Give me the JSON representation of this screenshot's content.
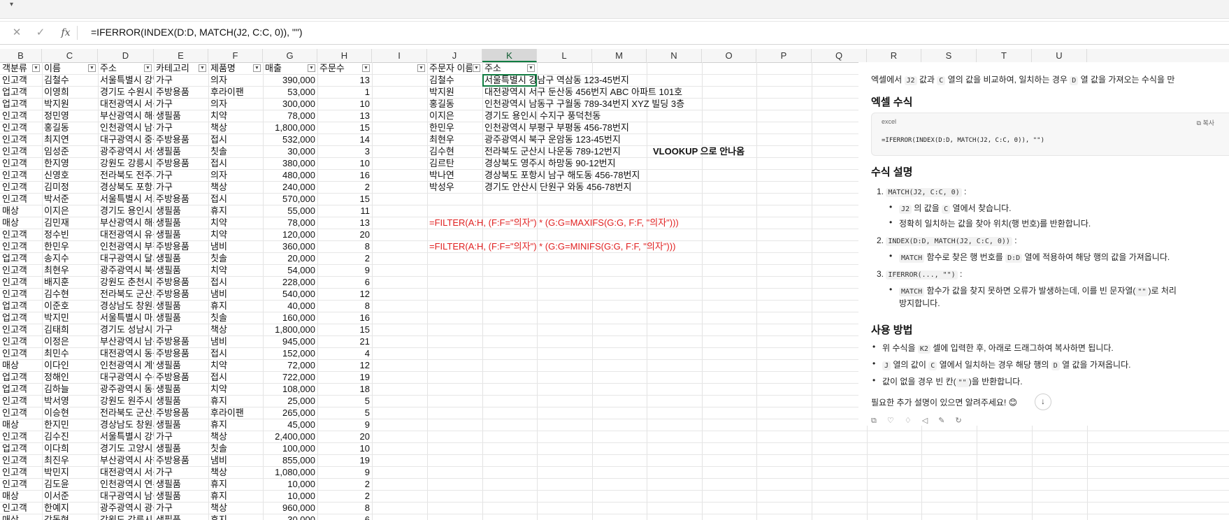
{
  "formula_bar": {
    "cancel_icon": "x-icon",
    "enter_icon": "check-icon",
    "fx_label": "fx",
    "formula": "=IFERROR(INDEX(D:D, MATCH(J2, C:C, 0)), \"\")"
  },
  "columns": [
    "B",
    "C",
    "D",
    "E",
    "F",
    "G",
    "H",
    "I",
    "J",
    "K",
    "L",
    "M",
    "N",
    "O",
    "P",
    "Q",
    "R",
    "S",
    "T",
    "U"
  ],
  "selected_column": "K",
  "table_left": {
    "headers": [
      "객분류",
      "이름",
      "주소",
      "카테고리",
      "제품명",
      "매출",
      "주문수"
    ],
    "rows": [
      [
        "인고객",
        "김철수",
        "서울특별시 강남구",
        "가구",
        "의자",
        "390,000",
        "13"
      ],
      [
        "업고객",
        "이영희",
        "경기도 수원시",
        "주방용품",
        "후라이팬",
        "53,000",
        "1"
      ],
      [
        "업고객",
        "박지원",
        "대전광역시 서구",
        "가구",
        "의자",
        "300,000",
        "10"
      ],
      [
        "인고객",
        "정민영",
        "부산광역시 해운대구",
        "생필품",
        "치약",
        "78,000",
        "13"
      ],
      [
        "인고객",
        "홍길동",
        "인천광역시 남동구",
        "가구",
        "책상",
        "1,800,000",
        "15"
      ],
      [
        "인고객",
        "최지연",
        "대구광역시 중구",
        "주방용품",
        "접시",
        "532,000",
        "14"
      ],
      [
        "인고객",
        "임성준",
        "광주광역시 서구",
        "생필품",
        "칫솔",
        "30,000",
        "3"
      ],
      [
        "인고객",
        "한지영",
        "강원도 강릉시",
        "주방용품",
        "접시",
        "380,000",
        "10"
      ],
      [
        "인고객",
        "신영호",
        "전라북도 전주시",
        "가구",
        "의자",
        "480,000",
        "16"
      ],
      [
        "인고객",
        "김미정",
        "경상북도 포항시",
        "가구",
        "책상",
        "240,000",
        "2"
      ],
      [
        "인고객",
        "박서준",
        "서울특별시 서초구",
        "주방용품",
        "접시",
        "570,000",
        "15"
      ],
      [
        "매상",
        "이지은",
        "경기도 용인시",
        "생필품",
        "휴지",
        "55,000",
        "11"
      ],
      [
        "매상",
        "김민재",
        "부산광역시 해운대구",
        "생필품",
        "치약",
        "78,000",
        "13"
      ],
      [
        "인고객",
        "정수빈",
        "대전광역시 유성구",
        "생필품",
        "치약",
        "120,000",
        "20"
      ],
      [
        "인고객",
        "한민우",
        "인천광역시 부평구",
        "주방용품",
        "냄비",
        "360,000",
        "8"
      ],
      [
        "업고객",
        "송지수",
        "대구광역시 달서구",
        "생필품",
        "칫솔",
        "20,000",
        "2"
      ],
      [
        "인고객",
        "최현우",
        "광주광역시 북구",
        "생필품",
        "치약",
        "54,000",
        "9"
      ],
      [
        "인고객",
        "배지훈",
        "강원도 춘천시",
        "주방용품",
        "접시",
        "228,000",
        "6"
      ],
      [
        "인고객",
        "김수현",
        "전라북도 군산시",
        "주방용품",
        "냄비",
        "540,000",
        "12"
      ],
      [
        "업고객",
        "이준호",
        "경상남도 창원시",
        "생필품",
        "휴지",
        "40,000",
        "8"
      ],
      [
        "업고객",
        "박지민",
        "서울특별시 마포구",
        "생필품",
        "칫솔",
        "160,000",
        "16"
      ],
      [
        "인고객",
        "김태희",
        "경기도 성남시",
        "가구",
        "책상",
        "1,800,000",
        "15"
      ],
      [
        "인고객",
        "이정은",
        "부산광역시 남구",
        "주방용품",
        "냄비",
        "945,000",
        "21"
      ],
      [
        "인고객",
        "최민수",
        "대전광역시 동구",
        "주방용품",
        "접시",
        "152,000",
        "4"
      ],
      [
        "매상",
        "이다인",
        "인천광역시 계양구",
        "생필품",
        "치약",
        "72,000",
        "12"
      ],
      [
        "업고객",
        "정해인",
        "대구광역시 수성구",
        "주방용품",
        "접시",
        "722,000",
        "19"
      ],
      [
        "업고객",
        "김하늘",
        "광주광역시 동구",
        "생필품",
        "치약",
        "108,000",
        "18"
      ],
      [
        "인고객",
        "박서영",
        "강원도 원주시",
        "생필품",
        "휴지",
        "25,000",
        "5"
      ],
      [
        "인고객",
        "이승현",
        "전라북도 군산시",
        "주방용품",
        "후라이팬",
        "265,000",
        "5"
      ],
      [
        "매상",
        "한지민",
        "경상남도 창원시",
        "생필품",
        "휴지",
        "45,000",
        "9"
      ],
      [
        "인고객",
        "김수진",
        "서울특별시 강남구",
        "가구",
        "책상",
        "2,400,000",
        "20"
      ],
      [
        "업고객",
        "이다희",
        "경기도 고양시",
        "생필품",
        "칫솔",
        "100,000",
        "10"
      ],
      [
        "인고객",
        "최진우",
        "부산광역시 사하구",
        "주방용품",
        "냄비",
        "855,000",
        "19"
      ],
      [
        "인고객",
        "박민지",
        "대전광역시 서구",
        "가구",
        "책상",
        "1,080,000",
        "9"
      ],
      [
        "인고객",
        "김도윤",
        "인천광역시 연수구",
        "생필품",
        "휴지",
        "10,000",
        "2"
      ],
      [
        "매상",
        "이서준",
        "대구광역시 남구",
        "생필품",
        "휴지",
        "10,000",
        "2"
      ],
      [
        "인고객",
        "한예지",
        "광주광역시 광산구",
        "가구",
        "책상",
        "960,000",
        "8"
      ],
      [
        "매상",
        "강동현",
        "강원도 강릉시",
        "생필품",
        "휴지",
        "30,000",
        "6"
      ]
    ]
  },
  "table_right": {
    "headers": [
      "주문자 이름",
      "주소"
    ],
    "rows": [
      [
        "김철수",
        "서울특별시 강남구 역삼동 123-45번지"
      ],
      [
        "박지원",
        "대전광역시 서구 둔산동 456번지 ABC 아파트 101호"
      ],
      [
        "홍길동",
        "인천광역시 남동구 구월동 789-34번지 XYZ 빌딩 3층"
      ],
      [
        "이지은",
        "경기도 용인시 수지구 풍덕천동"
      ],
      [
        "한민우",
        "인천광역시 부평구 부평동 456-78번지"
      ],
      [
        "최현우",
        "광주광역시 북구 운암동 123-45번지"
      ],
      [
        "김수현",
        "전라북도 군산시 나운동 789-12번지"
      ],
      [
        "김르탄",
        "경상북도 영주시 하망동 90-12번지"
      ],
      [
        "박나연",
        "경상북도 포항시 남구 해도동 456-78번지"
      ],
      [
        "박성우",
        "경기도 안산시 단원구 와동 456-78번지"
      ]
    ],
    "note": "VLOOKUP 으로 안나옴",
    "filter_max": "=FILTER(A:H, (F:F=\"의자\") * (G:G=MAXIFS(G:G, F:F, \"의자\")))",
    "filter_min": "=FILTER(A:H, (F:F=\"의자\") * (G:G=MINIFS(G:G, F:F, \"의자\")))"
  },
  "chat": {
    "intro_a": "엑셀에서 ",
    "intro_j2": "J2",
    "intro_b": " 값과 ",
    "intro_c": "C",
    "intro_c2": " 열의 값을 비교하여, 일치하는 경우 ",
    "intro_d": "D",
    "intro_e": " 열 값을 가져오는 수식을 만",
    "h_formula": "엑셀 수식",
    "code_lang": "excel",
    "code_copy": "복사",
    "copy_icon": "copy-icon",
    "code": "=IFERROR(INDEX(D:D, MATCH(J2, C:C, 0)), \"\")",
    "h_explain": "수식 설명",
    "n1": "1.",
    "item1_code": "MATCH(J2, C:C, 0)",
    "item1_b1_code1": "J2",
    "item1_b1_mid": " 의 값을 ",
    "item1_b1_code2": "C",
    "item1_b1_end": " 열에서 찾습니다.",
    "item1_b2": "정확히 일치하는 값을 찾아 위치(행 번호)를 반환합니다.",
    "n2": "2.",
    "item2_code": "INDEX(D:D, MATCH(J2, C:C, 0))",
    "item2_b1_code1": "MATCH",
    "item2_b1_mid": " 함수로 찾은 행 번호를 ",
    "item2_b1_code2": "D:D",
    "item2_b1_end": " 열에 적용하여 해당 행의 값을 가져옵니다.",
    "n3": "3.",
    "item3_code": "IFERROR(..., \"\")",
    "item3_b1_code1": "MATCH",
    "item3_b1_mid": " 함수가 값을 찾지 못하면 오류가 발생하는데, 이를 빈 문자열(",
    "item3_b1_code2": "\"\"",
    "item3_b1_end": ")로 처리",
    "item3_b1_cont": "방지합니다.",
    "h_usage": "사용 방법",
    "u1_a": "위 수식을 ",
    "u1_code": "K2",
    "u1_b": " 셀에 입력한 후, 아래로 드래그하여 복사하면 됩니다.",
    "u2_code1": "J",
    "u2_a": " 열의 값이 ",
    "u2_code2": "C",
    "u2_b": " 열에서 일치하는 경우 해당 행의 ",
    "u2_code3": "D",
    "u2_c": " 열 값을 가져옵니다.",
    "u3_a": "값이 없을 경우 빈 칸(",
    "u3_code": "\"\"",
    "u3_b": ")을 반환합니다.",
    "outro": "필요한 추가 설명이 있으면 알려주세요! 😊",
    "scroll_icon": "arrow-down-icon"
  }
}
